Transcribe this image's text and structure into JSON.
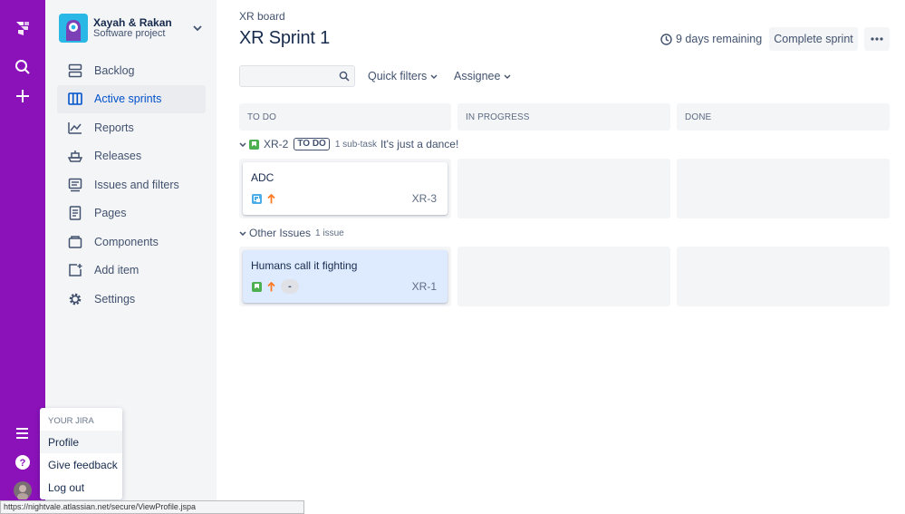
{
  "app": {
    "brand_color": "#8a12b8",
    "accent_color": "#0052cc"
  },
  "global_nav": {
    "icons": [
      "jira-logo-icon",
      "search-icon",
      "plus-icon",
      "hamburger-menu-icon",
      "help-icon",
      "user-avatar"
    ]
  },
  "project": {
    "name": "Xayah & Rakan",
    "type": "Software project"
  },
  "sidebar": {
    "items": [
      {
        "label": "Backlog",
        "icon": "backlog-icon",
        "active": false
      },
      {
        "label": "Active sprints",
        "icon": "board-icon",
        "active": true
      },
      {
        "label": "Reports",
        "icon": "chart-icon",
        "active": false
      },
      {
        "label": "Releases",
        "icon": "ship-icon",
        "active": false
      },
      {
        "label": "Issues and filters",
        "icon": "issues-icon",
        "active": false
      },
      {
        "label": "Pages",
        "icon": "page-icon",
        "active": false
      },
      {
        "label": "Components",
        "icon": "component-icon",
        "active": false
      },
      {
        "label": "Add item",
        "icon": "add-item-icon",
        "active": false
      },
      {
        "label": "Settings",
        "icon": "gear-icon",
        "active": false
      }
    ]
  },
  "header": {
    "breadcrumb": "XR board",
    "title": "XR Sprint 1",
    "days_remaining": "9 days remaining",
    "complete_label": "Complete sprint"
  },
  "filters": {
    "search_placeholder": "",
    "quick_filters": "Quick filters",
    "assignee": "Assignee"
  },
  "columns": [
    "TO DO",
    "IN PROGRESS",
    "DONE"
  ],
  "swimlanes": [
    {
      "key": "XR-2",
      "status": "TO DO",
      "subtasks": "1 sub-task",
      "summary": "It's just a dance!",
      "cards": [
        {
          "title": "ADC",
          "key": "XR-3",
          "type": "subtask",
          "priority": "high",
          "column": "TO DO"
        }
      ]
    },
    {
      "label": "Other Issues",
      "count": "1 issue",
      "cards": [
        {
          "title": "Humans call it fighting",
          "key": "XR-1",
          "type": "story",
          "priority": "high",
          "estimate": "-",
          "column": "TO DO",
          "selected": true
        }
      ]
    }
  ],
  "user_menu": {
    "heading": "YOUR JIRA",
    "items": [
      "Profile",
      "Give feedback",
      "Log out"
    ],
    "highlighted": "Profile"
  },
  "status_bar": {
    "url": "https://nightvale.atlassian.net/secure/ViewProfile.jspa"
  }
}
